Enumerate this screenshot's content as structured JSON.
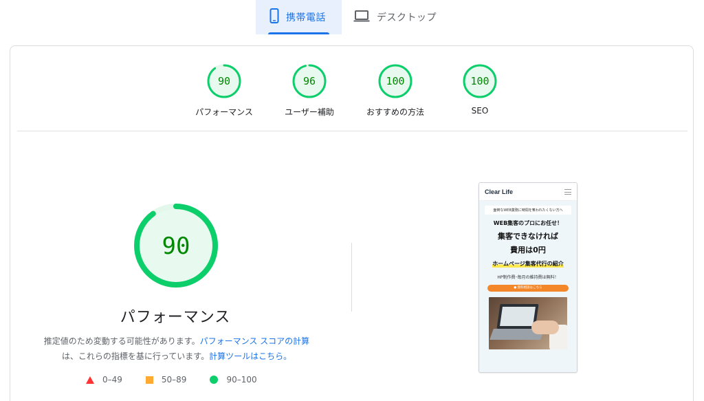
{
  "tabs": {
    "mobile_label": "携帯電話",
    "desktop_label": "デスクトップ",
    "selected": "mobile"
  },
  "categories": [
    {
      "label": "パフォーマンス",
      "score": 90,
      "color": "#0cce6b"
    },
    {
      "label": "ユーザー補助",
      "score": 96,
      "color": "#0cce6b"
    },
    {
      "label": "おすすめの方法",
      "score": 100,
      "color": "#0cce6b"
    },
    {
      "label": "SEO",
      "score": 100,
      "color": "#0cce6b"
    }
  ],
  "main": {
    "score": 90,
    "title": "パフォーマンス",
    "desc_text1": "推定値のため変動する可能性があります。",
    "desc_link1": "パフォーマンス スコアの計算",
    "desc_text2": "は、これらの指標を基に行っています。",
    "desc_link2": "計算ツールはこちら。"
  },
  "legend": [
    {
      "range": "0–49",
      "shape": "triangle",
      "color": "#ff3333"
    },
    {
      "range": "50–89",
      "shape": "square",
      "color": "#ffaa33"
    },
    {
      "range": "90–100",
      "shape": "circle",
      "color": "#0cce6b"
    }
  ],
  "screenshot": {
    "logo": "Clear Life",
    "pill": "面倒なWEB業務に時間を奪われたくない方へ",
    "line1": "WEB集客のプロにお任せ！",
    "line2": "集客できなければ",
    "line3": "費用は0円",
    "line4": "ホームページ集客代行の紹介",
    "line5": "HP制作費･毎月の維持費は無料！",
    "button": "● 無料相談はこちら"
  },
  "colors": {
    "accent": "#1a73e8",
    "pass": "#0cce6b",
    "pass_text": "#008800"
  }
}
